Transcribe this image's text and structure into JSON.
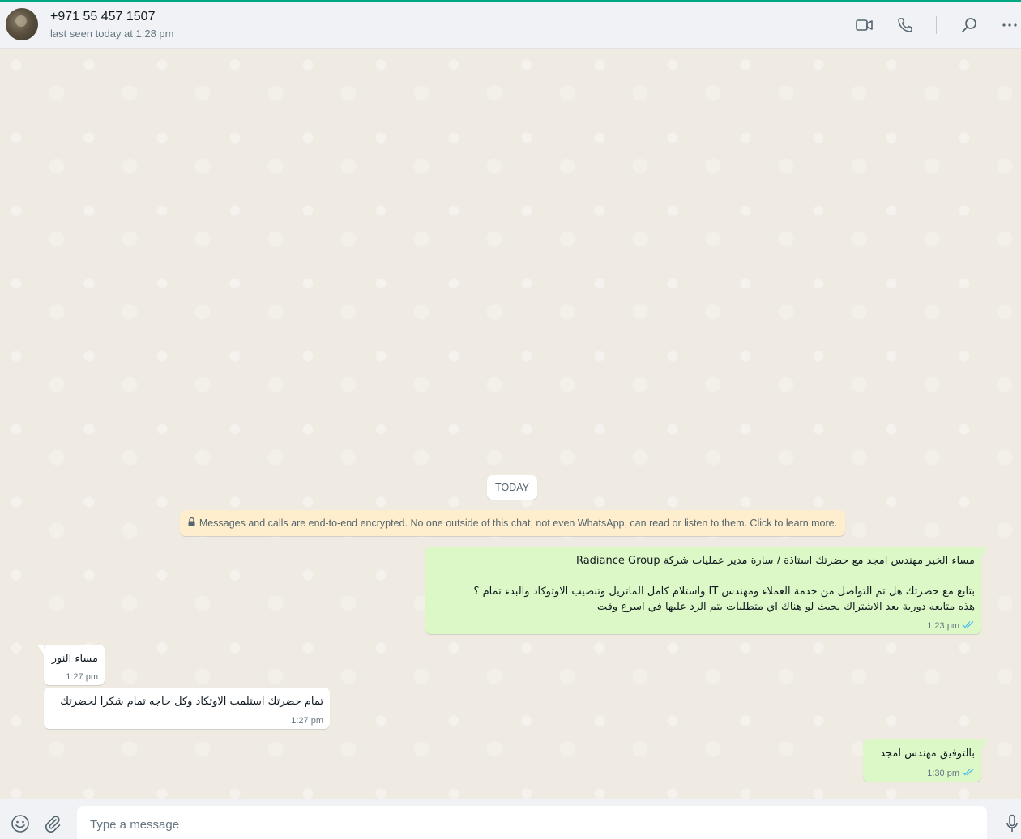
{
  "header": {
    "contact_name": "+971 55 457 1507",
    "status": "last seen today at 1:28 pm",
    "icons": [
      "video-call-icon",
      "voice-call-icon",
      "search-icon",
      "more-options-icon"
    ]
  },
  "chat": {
    "date_divider": "TODAY",
    "encryption_notice": "Messages and calls are end-to-end encrypted. No one outside of this chat, not even WhatsApp, can read or listen to them. Click to learn more.",
    "messages": [
      {
        "direction": "outgoing",
        "text": "مساء الخير مهندس امجد مع حضرتك استاذة / سارة مدير عمليات شركة Radiance Group\n\nبتابع مع حضرتك هل تم التواصل من خدمة العملاء ومهندس IT واستلام كامل الماتريل وتنصيب الاوتوكاد والبدء تمام ؟\nهذه متابعه دورية بعد الاشتراك بحيث لو هناك اي متطلبات يتم الرد عليها في اسرع وقت",
        "time": "1:23 pm",
        "status": "read"
      },
      {
        "direction": "incoming",
        "text": "مساء النور",
        "time": "1:27 pm"
      },
      {
        "direction": "incoming",
        "text": "تمام حضرتك استلمت الاوتكاد وكل حاجه تمام شكرا لحضرتك",
        "time": "1:27 pm"
      },
      {
        "direction": "outgoing",
        "text": "بالتوفيق مهندس  امجد",
        "time": "1:30 pm",
        "status": "read"
      }
    ]
  },
  "composer": {
    "placeholder": "Type a message",
    "icons": [
      "emoji-icon",
      "attach-icon",
      "microphone-icon"
    ]
  },
  "colors": {
    "accent": "#00a884",
    "outgoing_bubble": "#dcf8c6",
    "incoming_bubble": "#ffffff",
    "read_ticks": "#53bdeb",
    "chat_background": "#efeae2"
  }
}
